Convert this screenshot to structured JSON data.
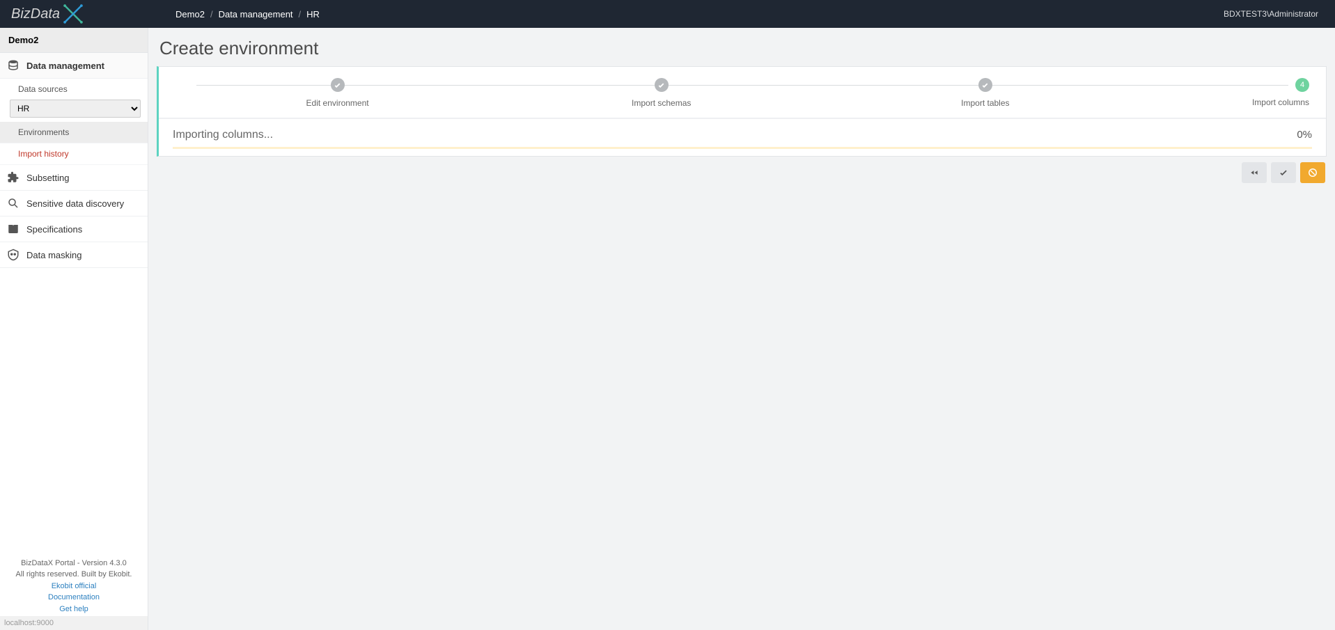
{
  "header": {
    "logo_text": "BizData",
    "breadcrumb": [
      "Demo2",
      "Data management",
      "HR"
    ],
    "user": "BDXTEST3\\Administrator"
  },
  "sidebar": {
    "project": "Demo2",
    "data_management": "Data management",
    "data_sources_label": "Data sources",
    "datasource_selected": "HR",
    "environments": "Environments",
    "import_history": "Import history",
    "subsetting": "Subsetting",
    "sensitive": "Sensitive data discovery",
    "specifications": "Specifications",
    "masking": "Data masking",
    "footer_line1": "BizDataX Portal - Version 4.3.0",
    "footer_line2": "All rights reserved. Built by Ekobit.",
    "link_official": "Ekobit official",
    "link_docs": "Documentation",
    "link_help": "Get help",
    "status_host": "localhost:9000"
  },
  "main": {
    "title": "Create environment",
    "steps": {
      "s1": "Edit environment",
      "s2": "Import schemas",
      "s3": "Import tables",
      "s4": "Import columns",
      "s4_num": "4"
    },
    "progress_label": "Importing columns...",
    "progress_pct": "0%"
  }
}
